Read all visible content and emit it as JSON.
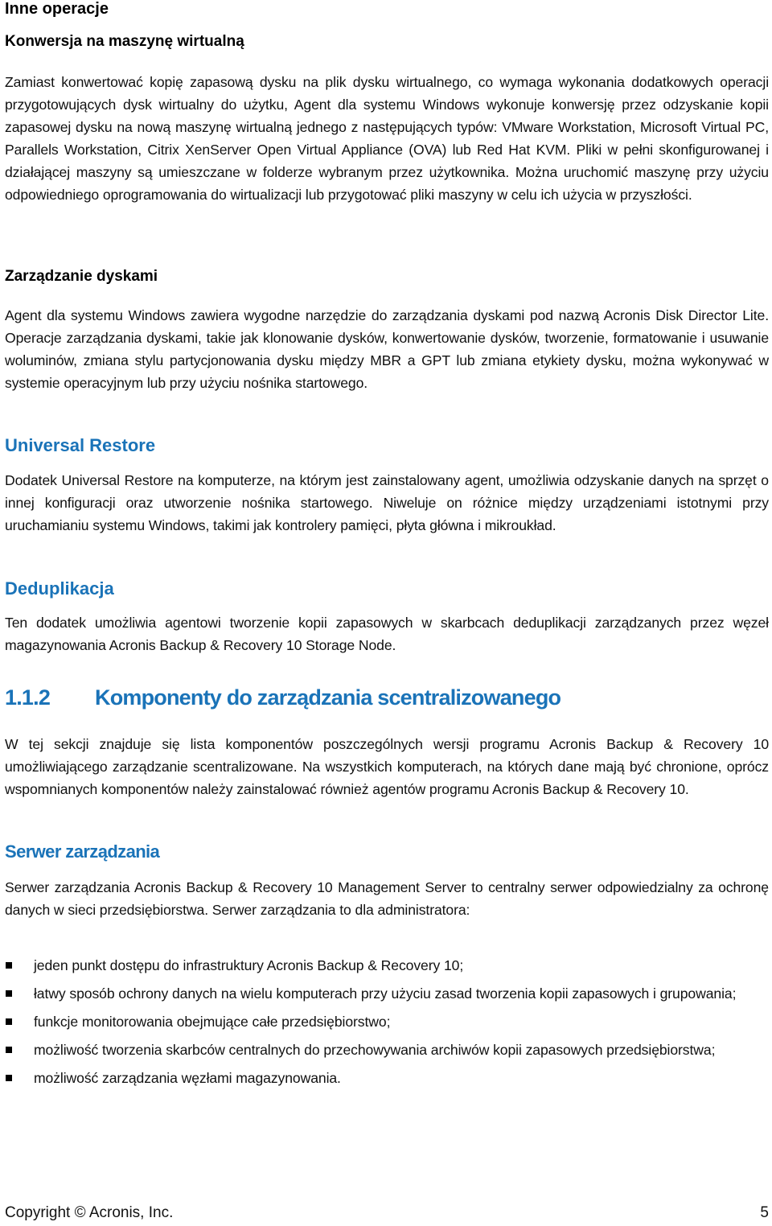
{
  "sections": {
    "inne_operacje": {
      "title": "Inne operacje",
      "subsections": {
        "konwersja": {
          "title": "Konwersja na maszynę wirtualną",
          "paragraph": "Zamiast konwertować kopię zapasową dysku na plik dysku wirtualnego, co wymaga wykonania dodatkowych operacji przygotowujących dysk wirtualny do użytku, Agent dla systemu Windows wykonuje konwersję przez odzyskanie kopii zapasowej dysku na nową maszynę wirtualną jednego z następujących typów: VMware Workstation, Microsoft Virtual PC, Parallels Workstation, Citrix XenServer Open Virtual Appliance (OVA) lub Red Hat KVM. Pliki w pełni skonfigurowanej i działającej maszyny są umieszczane w folderze wybranym przez użytkownika. Można uruchomić maszynę przy użyciu odpowiedniego oprogramowania do wirtualizacji lub przygotować pliki maszyny w celu ich użycia w przyszłości."
        },
        "zarzadzanie_dyskami": {
          "title": "Zarządzanie dyskami",
          "paragraph": "Agent dla systemu Windows zawiera wygodne narzędzie do zarządzania dyskami pod nazwą Acronis Disk Director Lite. Operacje zarządzania dyskami, takie jak klonowanie dysków, konwertowanie dysków, tworzenie, formatowanie i usuwanie woluminów, zmiana stylu partycjonowania dysku między MBR a GPT lub zmiana etykiety dysku, można wykonywać w systemie operacyjnym lub przy użyciu nośnika startowego."
        }
      }
    },
    "universal_restore": {
      "title": "Universal Restore",
      "paragraph": "Dodatek Universal Restore na komputerze, na którym jest zainstalowany agent, umożliwia odzyskanie danych na sprzęt o innej konfiguracji oraz utworzenie nośnika startowego. Niweluje on różnice między urządzeniami istotnymi przy uruchamianiu systemu Windows, takimi jak kontrolery pamięci, płyta główna i mikroukład."
    },
    "deduplikacja": {
      "title": "Deduplikacja",
      "paragraph": "Ten dodatek umożliwia agentowi tworzenie kopii zapasowych w skarbcach deduplikacji zarządzanych przez węzeł magazynowania Acronis Backup & Recovery 10 Storage Node."
    },
    "komponenty": {
      "number": "1.1.2",
      "title": "Komponenty do zarządzania scentralizowanego",
      "paragraph": "W tej sekcji znajduje się lista komponentów poszczególnych wersji programu Acronis Backup & Recovery 10 umożliwiającego zarządzanie scentralizowane. Na wszystkich komputerach, na których dane mają być chronione, oprócz wspomnianych komponentów należy zainstalować również agentów programu Acronis Backup & Recovery 10."
    },
    "serwer_zarzadzania": {
      "title": "Serwer zarządzania",
      "paragraph": "Serwer zarządzania Acronis Backup & Recovery 10 Management Server to centralny serwer odpowiedzialny za ochronę danych w sieci przedsiębiorstwa. Serwer zarządzania to dla administratora:",
      "bullets": [
        "jeden punkt dostępu do infrastruktury Acronis Backup & Recovery 10;",
        "łatwy sposób ochrony danych na wielu komputerach przy użyciu zasad tworzenia kopii zapasowych i grupowania;",
        "funkcje monitorowania obejmujące całe przedsiębiorstwo;",
        "możliwość tworzenia skarbców centralnych do przechowywania archiwów kopii zapasowych przedsiębiorstwa;",
        "możliwość zarządzania węzłami magazynowania."
      ]
    }
  },
  "footer": {
    "copyright": "Copyright © Acronis, Inc.",
    "page_number": "5"
  },
  "colors": {
    "heading_blue": "#1a73b8",
    "text": "#111111"
  }
}
